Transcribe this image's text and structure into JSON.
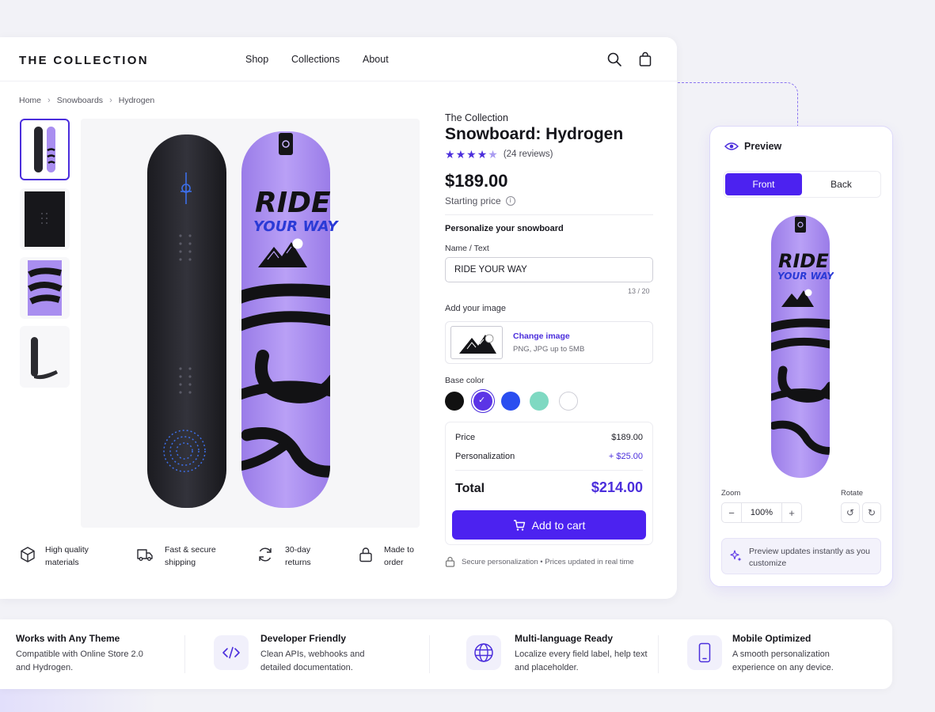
{
  "brand": "THE COLLECTION",
  "nav": {
    "shop": "Shop",
    "collections": "Collections",
    "about": "About"
  },
  "icons": {
    "search": "search-icon",
    "bag": "shopping-bag-icon"
  },
  "breadcrumb": [
    "Home",
    "Snowboards",
    "Hydrogen"
  ],
  "product": {
    "vendor": "The Collection",
    "title": "Snowboard: Hydrogen",
    "rating": 4.5,
    "reviews": "(24 reviews)",
    "price": "$189.00",
    "starting_label": "Starting price"
  },
  "personalize": {
    "heading": "Personalize your snowboard",
    "name_label": "Name / Text",
    "name_value": "RIDE YOUR WAY",
    "counter": "13 / 20",
    "image_label": "Add your image",
    "change_image": "Change image",
    "image_hint": "PNG, JPG up to 5MB",
    "base_color_label": "Base color",
    "colors": [
      "#111111",
      "#5b34e6",
      "#2a4ef0",
      "#7fd9c2",
      "#ffffff"
    ],
    "selected_color": 1
  },
  "summary": {
    "price_label": "Price",
    "price_value": "$189.00",
    "personalization_label": "Personalization",
    "personalization_value": "+ $25.00",
    "total_label": "Total",
    "total_value": "$214.00",
    "cart_button": "Add to cart"
  },
  "secure_note": "Secure personalization • Prices updated in real time",
  "features": [
    {
      "line1": "High quality",
      "line2": "materials",
      "icon": "cube-icon"
    },
    {
      "line1": "Fast & secure",
      "line2": "shipping",
      "icon": "truck-icon"
    },
    {
      "line1": "30-day",
      "line2": "returns",
      "icon": "refresh-icon"
    },
    {
      "line1": "Made to",
      "line2": "order",
      "icon": "lock-icon"
    }
  ],
  "board_text": {
    "line1": "RIDE",
    "line2": "YOUR WAY"
  },
  "preview": {
    "title": "Preview",
    "tab_front": "Front",
    "tab_back": "Back",
    "zoom_label": "Zoom",
    "zoom_value": "100%",
    "rotate_label": "Rotate",
    "note": "Preview updates instantly as you customize"
  },
  "bottom": [
    {
      "title": "Works with Any Theme",
      "desc": "Compatible with Online Store 2.0 and Hydrogen."
    },
    {
      "title": "Developer Friendly",
      "desc": "Clean APIs, webhooks and detailed documentation.",
      "icon": "code-icon"
    },
    {
      "title": "Multi-language Ready",
      "desc": "Localize every field label, help text and placeholder.",
      "icon": "globe-icon"
    },
    {
      "title": "Mobile Optimized",
      "desc": "A smooth personalization experience on any device.",
      "icon": "phone-icon"
    }
  ],
  "accent_color": "#4c22f0"
}
